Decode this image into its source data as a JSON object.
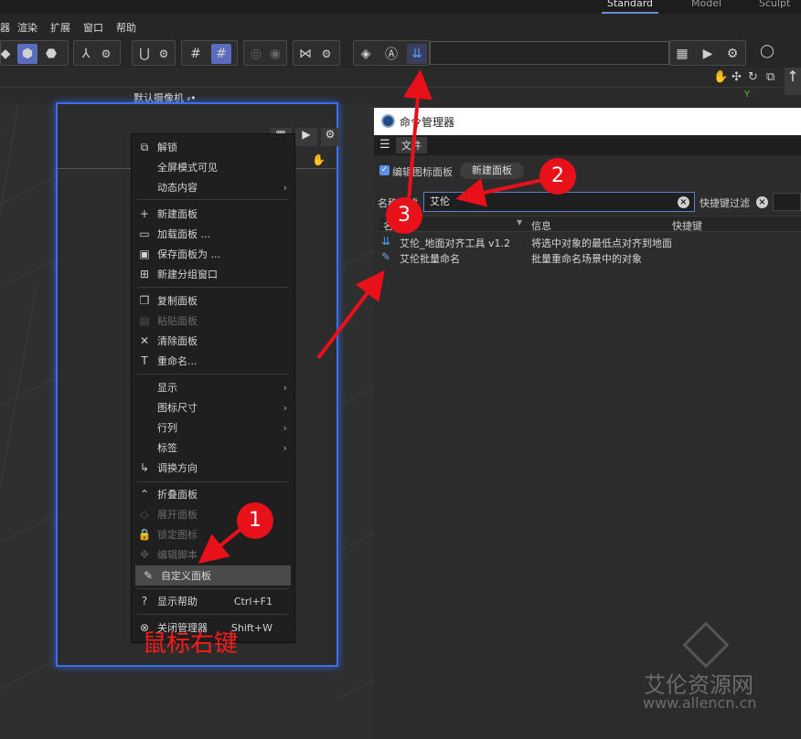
{
  "layouts": [
    "Standard",
    "Model",
    "Sculpt"
  ],
  "menu": [
    "器",
    "渲染",
    "扩展",
    "窗口",
    "帮助"
  ],
  "viewport": {
    "camera_label": "默认摄像机 ⸗•",
    "axis_y": "Y"
  },
  "context_menu": {
    "items": [
      {
        "icon": "⧉",
        "label": "解锁",
        "arrow": "",
        "shortcut": "",
        "disabled": false
      },
      {
        "icon": "",
        "label": "全屏模式可见",
        "arrow": "",
        "shortcut": "",
        "disabled": false
      },
      {
        "icon": "",
        "label": "动态内容",
        "arrow": "›",
        "shortcut": "",
        "disabled": false
      },
      {
        "icon": "+",
        "label": "新建面板",
        "arrow": "",
        "shortcut": "",
        "disabled": false
      },
      {
        "icon": "▭",
        "label": "加载面板 ...",
        "arrow": "",
        "shortcut": "",
        "disabled": false
      },
      {
        "icon": "▣",
        "label": "保存面板为 ...",
        "arrow": "",
        "shortcut": "",
        "disabled": false
      },
      {
        "icon": "⊞",
        "label": "新建分组窗口",
        "arrow": "",
        "shortcut": "",
        "disabled": false
      },
      {
        "icon": "❐",
        "label": "复制面板",
        "arrow": "",
        "shortcut": "",
        "disabled": false
      },
      {
        "icon": "▤",
        "label": "粘贴面板",
        "arrow": "",
        "shortcut": "",
        "disabled": true
      },
      {
        "icon": "✕",
        "label": "清除面板",
        "arrow": "",
        "shortcut": "",
        "disabled": false
      },
      {
        "icon": "T",
        "label": "重命名...",
        "arrow": "",
        "shortcut": "",
        "disabled": false
      },
      {
        "icon": "",
        "label": "显示",
        "arrow": "›",
        "shortcut": "",
        "disabled": false
      },
      {
        "icon": "",
        "label": "图标尺寸",
        "arrow": "›",
        "shortcut": "",
        "disabled": false
      },
      {
        "icon": "",
        "label": "行列",
        "arrow": "›",
        "shortcut": "",
        "disabled": false
      },
      {
        "icon": "",
        "label": "标签",
        "arrow": "›",
        "shortcut": "",
        "disabled": false
      },
      {
        "icon": "↳",
        "label": "调换方向",
        "arrow": "",
        "shortcut": "",
        "disabled": false
      },
      {
        "icon": "⌃",
        "label": "折叠面板",
        "arrow": "",
        "shortcut": "",
        "disabled": false
      },
      {
        "icon": "◇",
        "label": "展开面板",
        "arrow": "",
        "shortcut": "",
        "disabled": true
      },
      {
        "icon": "🔒",
        "label": "锁定图标",
        "arrow": "",
        "shortcut": "",
        "disabled": true
      },
      {
        "icon": "✥",
        "label": "编辑脚本",
        "arrow": "",
        "shortcut": "",
        "disabled": true
      },
      {
        "icon": "✎",
        "label": "自定义面板",
        "arrow": "",
        "shortcut": "",
        "disabled": false,
        "selected": true
      },
      {
        "icon": "?",
        "label": "显示帮助",
        "arrow": "",
        "shortcut": "Ctrl+F1",
        "disabled": false
      },
      {
        "icon": "⊗",
        "label": "关闭管理器",
        "arrow": "",
        "shortcut": "Shift+W",
        "disabled": false
      }
    ]
  },
  "command_manager": {
    "title": "命令管理器",
    "menu_file": "文件",
    "edit_icon_panel_label": "编辑图标面板",
    "new_panel_button": "新建面板",
    "name_filter_label": "名称过滤",
    "name_filter_value": "艾伦",
    "shortcut_filter_label": "快捷键过滤",
    "columns": [
      "名称",
      "信息",
      "快捷键"
    ],
    "rows": [
      {
        "name": "艾伦_地面对齐工具 v1.2",
        "info": "将选中对象的最低点对齐到地面"
      },
      {
        "name": "艾伦批量命名",
        "info": "批量重命名场景中的对象"
      }
    ]
  },
  "annotations": {
    "badge1": "1",
    "badge2": "2",
    "badge3": "3",
    "right_click_text": "鼠标右键",
    "color": "#e8111a"
  },
  "watermark": {
    "line1": "艾伦资源网",
    "line2": "www.allencn.cn"
  },
  "colors": {
    "accent": "#5b6bbd",
    "panel_glow": "#3b6ee8",
    "background": "#2b2b2b"
  }
}
